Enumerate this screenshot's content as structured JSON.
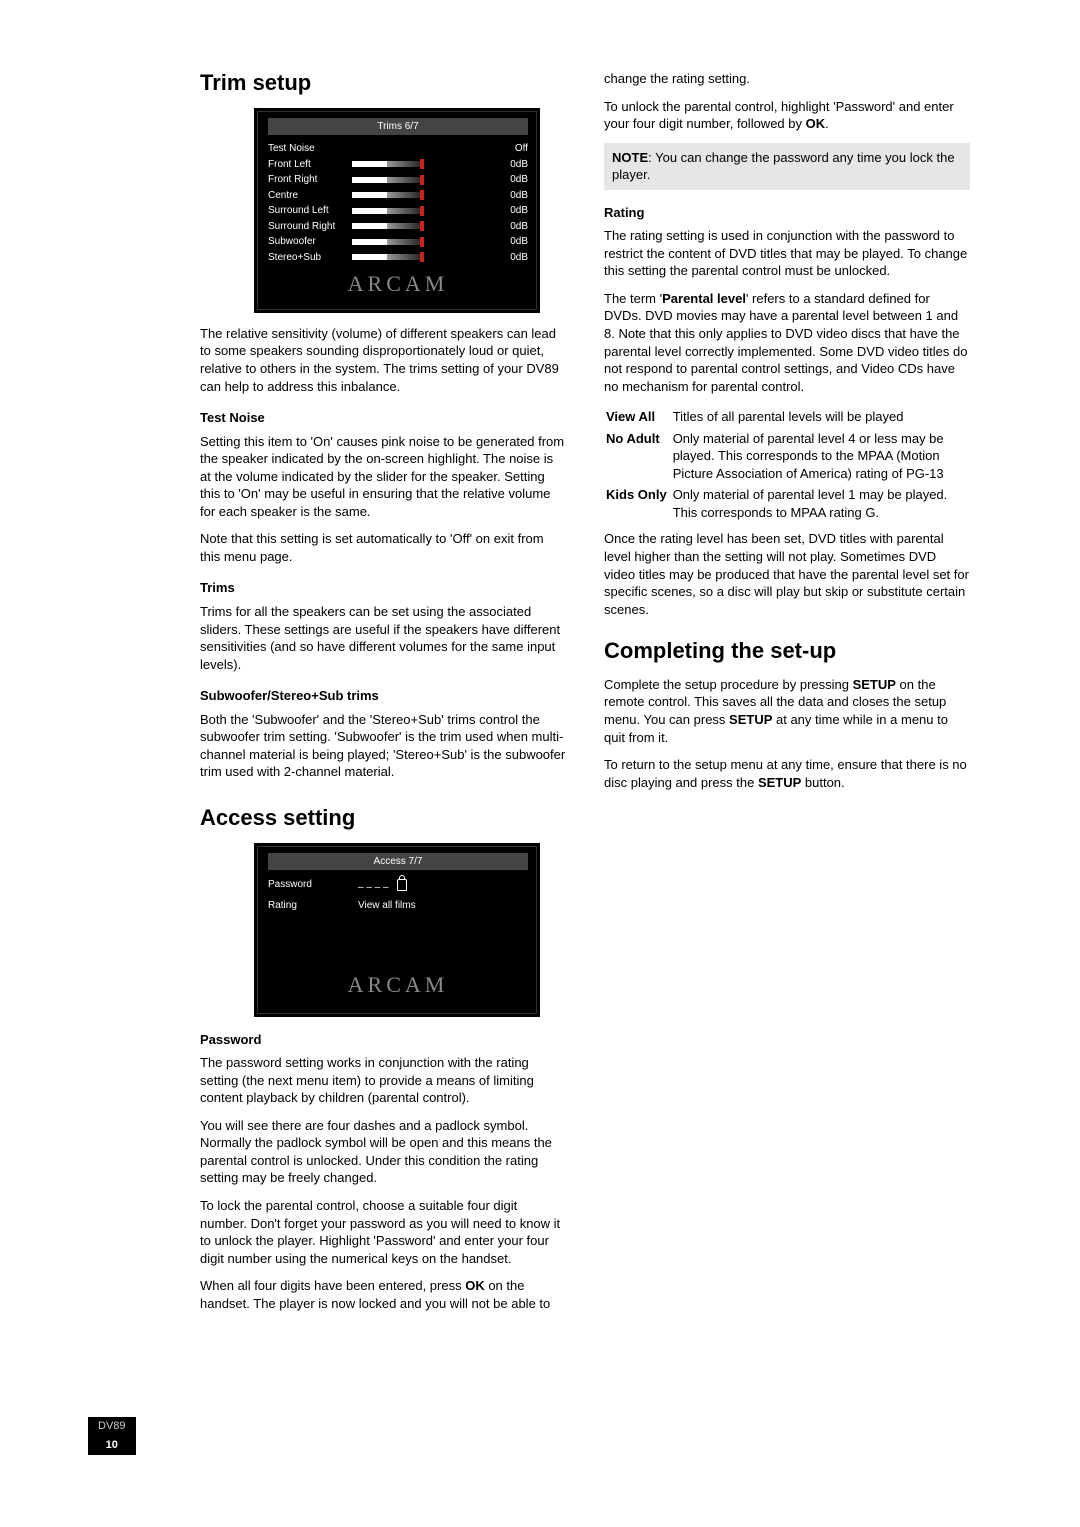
{
  "footer": {
    "model": "DV89",
    "page": "10"
  },
  "left": {
    "trim_heading": "Trim setup",
    "trim_panel": {
      "title": "Trims 6/7",
      "logo": "ARCAM",
      "rows": [
        {
          "name": "Test Noise",
          "value": "Off",
          "bar": false
        },
        {
          "name": "Front Left",
          "value": "0dB",
          "bar": true
        },
        {
          "name": "Front Right",
          "value": "0dB",
          "bar": true
        },
        {
          "name": "Centre",
          "value": "0dB",
          "bar": true
        },
        {
          "name": "Surround Left",
          "value": "0dB",
          "bar": true
        },
        {
          "name": "Surround Right",
          "value": "0dB",
          "bar": true
        },
        {
          "name": "Subwoofer",
          "value": "0dB",
          "bar": true
        },
        {
          "name": "Stereo+Sub",
          "value": "0dB",
          "bar": true
        }
      ]
    },
    "trim_intro": "The relative sensitivity (volume) of different speakers can lead to some speakers sounding disproportionately loud or quiet, relative to others in the system. The trims setting of your DV89 can help to address this inbalance.",
    "testnoise_h": "Test Noise",
    "testnoise_p1": "Setting this item to 'On' causes pink noise to be generated from the speaker indicated by the on-screen highlight. The noise is at the volume indicated by the slider for the speaker. Setting this to 'On' may be useful in ensuring that the relative volume for each speaker is the same.",
    "testnoise_p2": "Note that this setting is set automatically to 'Off' on exit from this menu page.",
    "trims_h": "Trims",
    "trims_p": "Trims for all the speakers can be set using the associated sliders. These settings are useful if the speakers have different sensitivities (and so have different volumes for the same input levels).",
    "sub_h": "Subwoofer/Stereo+Sub trims",
    "sub_p": "Both the 'Subwoofer' and the 'Stereo+Sub' trims control the subwoofer trim setting. 'Subwoofer' is the trim used when multi-channel material is being played; 'Stereo+Sub' is the subwoofer trim used with 2-channel material.",
    "access_heading": "Access setting",
    "access_panel": {
      "title": "Access 7/7",
      "password_label": "Password",
      "password_value": "– – – –",
      "rating_label": "Rating",
      "rating_value": "View all films",
      "logo": "ARCAM"
    },
    "password_h": "Password",
    "password_p1": "The password setting works in conjunction with the rating setting (the next menu item) to provide a means of limiting content playback by children (parental control).",
    "password_p2": "You will see there are four dashes and a padlock symbol. Normally the padlock symbol will be open and this means the parental control is unlocked. Under this condition the rating setting may be freely changed.",
    "password_p3": "To lock the parental control, choose a suitable four digit number. Don't forget your password as you will need to know it to unlock the player. Highlight 'Password' and enter your four digit number using the numerical keys on the handset.",
    "password_p4_a": "When all four digits have been entered, press ",
    "password_p4_ok": "OK",
    "password_p4_b": " on the handset. The player is now locked and you will not be able to"
  },
  "right": {
    "cont1": "change the rating setting.",
    "cont2_a": "To unlock the parental control, highlight 'Password' and enter your four digit number, followed by ",
    "cont2_ok": "OK",
    "cont2_b": ".",
    "note_label": "NOTE",
    "note_body": ":  You can change the password any time you lock the player.",
    "rating_h": "Rating",
    "rating_p1": "The rating setting is used in conjunction with the password to restrict the content of DVD titles that may be played. To change this setting the parental control must be unlocked.",
    "rating_p2_a": "The term '",
    "rating_p2_b": "Parental level",
    "rating_p2_c": "' refers to a standard defined for DVDs. DVD movies may have a parental level between 1 and 8. Note that this only applies to DVD video discs that have the parental level correctly implemented. Some DVD video titles do not respond to parental control settings, and Video CDs have no mechanism for parental control.",
    "rating_rows": [
      {
        "name": "View All",
        "desc": "Titles of all parental levels will be played"
      },
      {
        "name": "No Adult",
        "desc": "Only material of parental level 4 or less may be played. This corresponds to the MPAA (Motion Picture Association of America) rating of PG-13"
      },
      {
        "name": "Kids Only",
        "desc": "Only material of parental level 1 may be played. This corresponds to MPAA rating G."
      }
    ],
    "rating_after": "Once the rating level has been set, DVD titles with parental level higher than the setting will not play. Sometimes DVD video titles may be produced that have the parental level set for specific scenes, so a disc will play but skip or substitute certain scenes.",
    "complete_heading": "Completing the set-up",
    "complete_p1_a": "Complete the setup procedure by pressing ",
    "complete_setup": "SETUP",
    "complete_p1_b": " on the remote control. This saves all the data and closes the setup menu. You can press ",
    "complete_p1_c": " at any time while in a menu to quit from it.",
    "complete_p2_a": "To return to the setup menu at any time, ensure that there is no disc playing and press the ",
    "complete_p2_b": " button."
  }
}
